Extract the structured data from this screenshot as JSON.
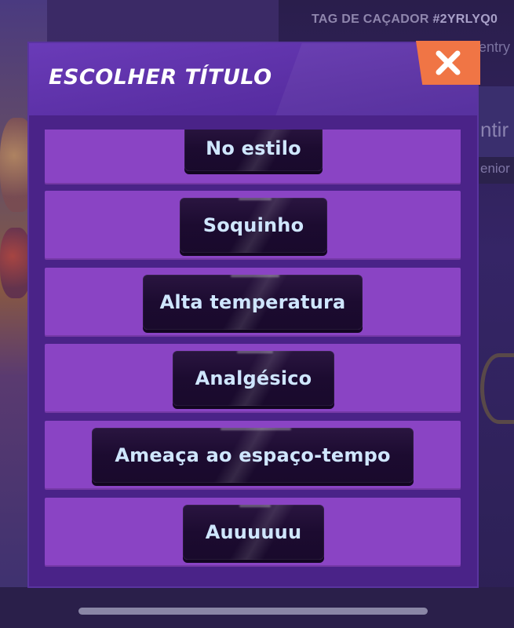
{
  "background": {
    "hunter_tag_label": "TAG DE CAÇADOR",
    "hunter_tag_value": "#2YRLYQ0",
    "sub_text_1": "entry",
    "sub_text_2": "ntir",
    "sub_text_3": "enior"
  },
  "modal": {
    "title": "ESCOLHER TÍTULO",
    "close_icon": "close-x-icon",
    "titles": [
      {
        "label": "No estilo"
      },
      {
        "label": "Soquinho"
      },
      {
        "label": "Alta temperatura"
      },
      {
        "label": "Analgésico"
      },
      {
        "label": "Ameaça ao espaço-tempo"
      },
      {
        "label": "Auuuuuu"
      }
    ]
  },
  "colors": {
    "modal_bg": "#4a2388",
    "row_bg": "#8a44c4",
    "button_bg": "#1c0b30",
    "button_text": "#cfe6ff",
    "close_accent": "#f07545"
  }
}
